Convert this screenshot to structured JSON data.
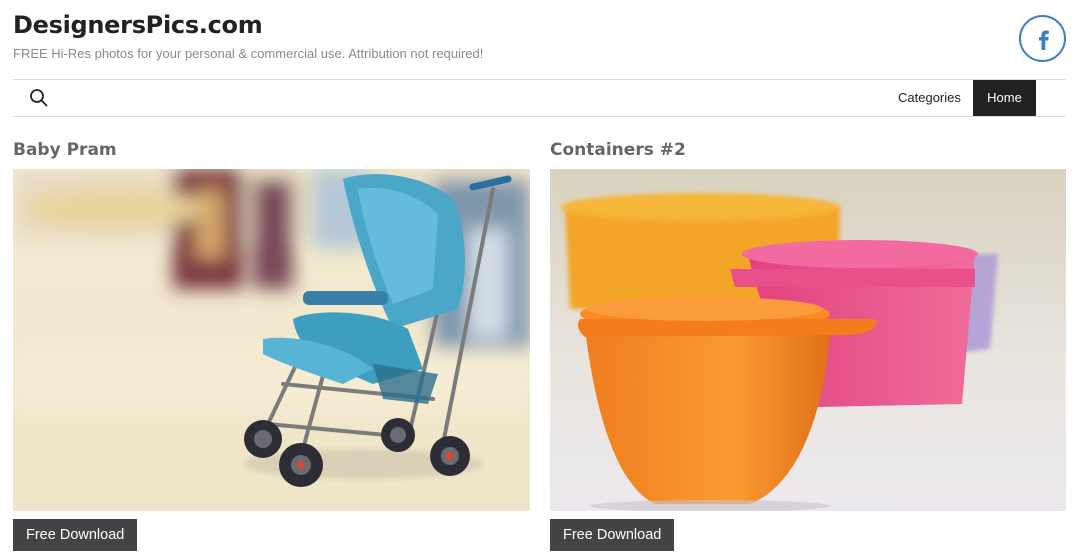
{
  "site": {
    "title": "DesignersPics.com",
    "tagline": "FREE Hi-Res photos for your personal & commercial use. Attribution not required!"
  },
  "social": {
    "icon": "facebook-icon",
    "color": "#3b7fc4"
  },
  "nav": {
    "search_icon": "search-icon",
    "items": [
      {
        "label": "Categories",
        "active": false
      },
      {
        "label": "Home",
        "active": true
      }
    ]
  },
  "photos": [
    {
      "title": "Baby Pram",
      "button_label": "Free Download"
    },
    {
      "title": "Containers #2",
      "button_label": "Free Download"
    }
  ],
  "colors": {
    "nav_active_bg": "#222222",
    "button_bg": "#444444",
    "title_color": "#666666"
  }
}
